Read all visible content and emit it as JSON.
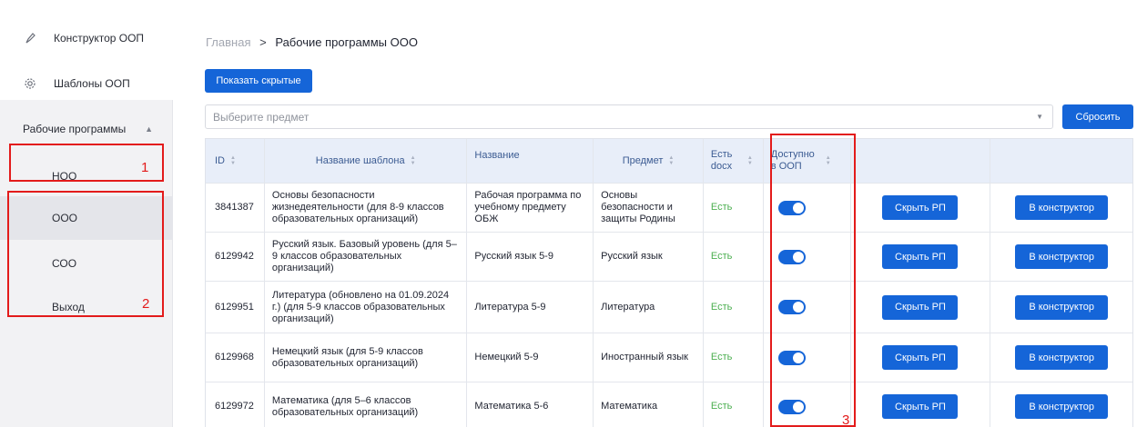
{
  "sidebar": {
    "constructor_label": "Конструктор ООП",
    "templates_label": "Шаблоны ООП",
    "section_label": "Рабочие программы",
    "items": [
      {
        "label": "НОО"
      },
      {
        "label": "ООО"
      },
      {
        "label": "СОО"
      },
      {
        "label": "Выход"
      }
    ]
  },
  "breadcrumb": {
    "home": "Главная",
    "separator": ">",
    "current": "Рабочие программы ООО"
  },
  "toolbar": {
    "show_hidden_label": "Показать скрытые",
    "reset_label": "Сбросить"
  },
  "filter": {
    "placeholder": "Выберите предмет"
  },
  "table": {
    "headers": {
      "id": "ID",
      "template": "Название шаблона",
      "name": "Название",
      "subject": "Предмет",
      "docx": "Есть docx",
      "available": "Доступно в ООП"
    },
    "rows": [
      {
        "id": "3841387",
        "template": "Основы безопасности жизнедеятельности (для 8-9 классов образовательных организаций)",
        "name": "Рабочая программа по учебному предмету ОБЖ",
        "subject": "Основы безопасности и защиты Родины",
        "docx": "Есть",
        "available": true,
        "hide_label": "Скрыть РП",
        "constructor_label": "В конструктор"
      },
      {
        "id": "6129942",
        "template": "Русский язык. Базовый уровень (для 5–9 классов образовательных организаций)",
        "name": "Русский язык 5-9",
        "subject": "Русский язык",
        "docx": "Есть",
        "available": true,
        "hide_label": "Скрыть РП",
        "constructor_label": "В конструктор"
      },
      {
        "id": "6129951",
        "template": "Литература (обновлено на 01.09.2024 г.) (для 5-9 классов образовательных организаций)",
        "name": "Литература 5-9",
        "subject": "Литература",
        "docx": "Есть",
        "available": true,
        "hide_label": "Скрыть РП",
        "constructor_label": "В конструктор"
      },
      {
        "id": "6129968",
        "template": "Немецкий язык (для 5-9 классов образовательных организаций)",
        "name": "Немецкий 5-9",
        "subject": "Иностранный язык",
        "docx": "Есть",
        "available": true,
        "hide_label": "Скрыть РП",
        "constructor_label": "В конструктор"
      },
      {
        "id": "6129972",
        "template": "Математика (для 5–6 классов образовательных организаций)",
        "name": "Математика 5-6",
        "subject": "Математика",
        "docx": "Есть",
        "available": true,
        "hide_label": "Скрыть РП",
        "constructor_label": "В конструктор"
      }
    ]
  },
  "annotations": [
    "1",
    "2",
    "3"
  ],
  "colors": {
    "accent": "#1565d8",
    "status_green": "#4caf50",
    "annotation_red": "#e31b1b",
    "header_bg": "#e8eef9"
  }
}
